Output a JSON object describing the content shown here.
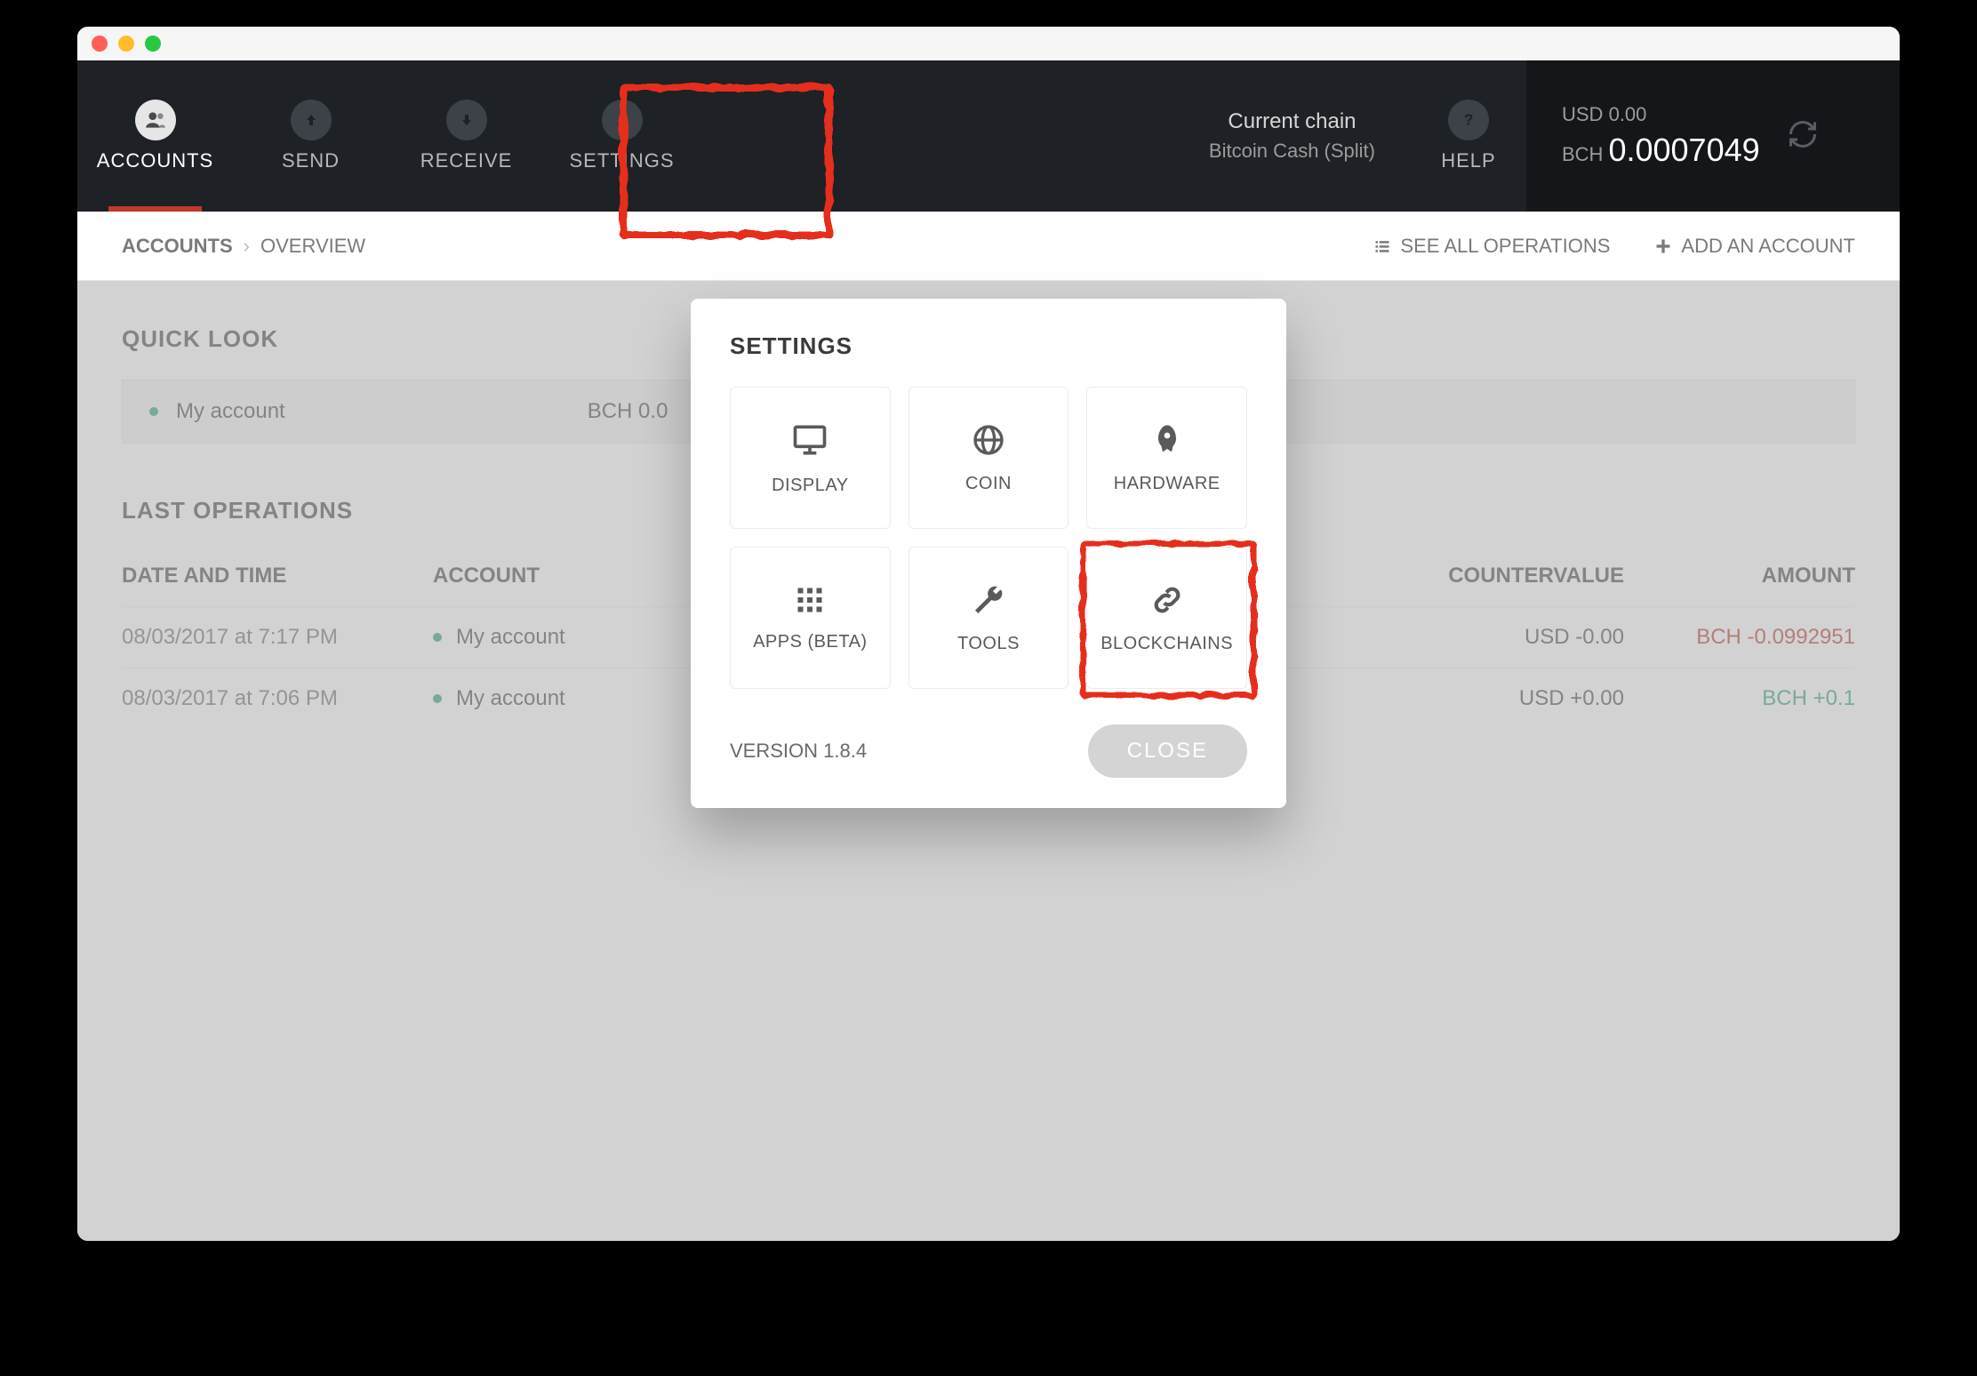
{
  "nav": {
    "items": [
      {
        "label": "ACCOUNTS",
        "icon": "users-icon"
      },
      {
        "label": "SEND",
        "icon": "arrow-up-icon"
      },
      {
        "label": "RECEIVE",
        "icon": "arrow-down-icon"
      },
      {
        "label": "SETTINGS",
        "icon": "gear-icon"
      }
    ],
    "help_label": "HELP"
  },
  "chain": {
    "title": "Current chain",
    "name": "Bitcoin Cash (Split)"
  },
  "balance": {
    "usd_label": "USD",
    "usd_value": "0.00",
    "bch_label": "BCH",
    "bch_value": "0.0007049"
  },
  "breadcrumb": {
    "root": "ACCOUNTS",
    "page": "OVERVIEW"
  },
  "subbar": {
    "see_all": "SEE ALL OPERATIONS",
    "add_account": "ADD AN ACCOUNT"
  },
  "quick_look": {
    "title": "QUICK LOOK",
    "account_name": "My account",
    "account_balance": "BCH 0.0"
  },
  "last_ops": {
    "title": "LAST OPERATIONS",
    "columns": {
      "date": "DATE AND TIME",
      "account": "ACCOUNT",
      "countervalue": "COUNTERVALUE",
      "amount": "AMOUNT"
    },
    "rows": [
      {
        "date": "08/03/2017 at 7:17 PM",
        "account": "My account",
        "countervalue": "USD -0.00",
        "amount": "BCH -0.0992951",
        "sign": "neg"
      },
      {
        "date": "08/03/2017 at 7:06 PM",
        "account": "My account",
        "countervalue": "USD +0.00",
        "amount": "BCH +0.1",
        "sign": "pos"
      }
    ]
  },
  "modal": {
    "title": "SETTINGS",
    "tiles": [
      {
        "label": "DISPLAY",
        "icon": "monitor-icon"
      },
      {
        "label": "COIN",
        "icon": "globe-icon"
      },
      {
        "label": "HARDWARE",
        "icon": "rocket-icon"
      },
      {
        "label": "APPS (BETA)",
        "icon": "grid-icon"
      },
      {
        "label": "TOOLS",
        "icon": "wrench-icon"
      },
      {
        "label": "BLOCKCHAINS",
        "icon": "chain-icon"
      }
    ],
    "version": "VERSION 1.8.4",
    "close": "CLOSE"
  }
}
